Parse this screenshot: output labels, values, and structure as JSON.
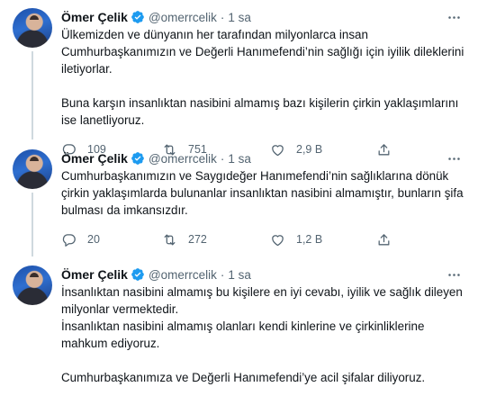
{
  "tweets": [
    {
      "author": {
        "name": "Ömer Çelik",
        "handle": "@omerrcelik",
        "verified": true
      },
      "separator": "·",
      "time": "1 sa",
      "text": [
        "Ülkemizden ve dünyanın her tarafından milyonlarca insan Cumhurbaşkanımızın ve Değerli Hanımefendi’nin sağlığı için iyilik dileklerini iletiyorlar.",
        "Buna karşın insanlıktan nasibini almamış bazı kişilerin çirkin yaklaşımlarını ise lanetliyoruz."
      ],
      "replies": "109",
      "retweets": "751",
      "likes": "2,9 B"
    },
    {
      "author": {
        "name": "Ömer Çelik",
        "handle": "@omerrcelik",
        "verified": true
      },
      "separator": "·",
      "time": "1 sa",
      "text": [
        "Cumhurbaşkanımızın ve Saygıdeğer Hanımefendi’nin sağlıklarına dönük çirkin yaklaşımlarda bulunanlar insanlıktan nasibini almamıştır, bunların şifa bulması da imkansızdır."
      ],
      "replies": "20",
      "retweets": "272",
      "likes": "1,2 B"
    },
    {
      "author": {
        "name": "Ömer Çelik",
        "handle": "@omerrcelik",
        "verified": true
      },
      "separator": "·",
      "time": "1 sa",
      "text": [
        "İnsanlıktan nasibini almamış bu kişilere en iyi cevabı, iyilik ve sağlık dileyen milyonlar vermektedir.",
        "İnsanlıktan nasibini almamış olanları kendi kinlerine ve çirkinliklerine mahkum ediyoruz.",
        "Cumhurbaşkanımıza ve Değerli Hanımefendi’ye acil şifalar diliyoruz."
      ]
    }
  ],
  "colors": {
    "text": "#0f1419",
    "muted": "#536471",
    "verified": "#1d9bf0",
    "thread_line": "#cfd9de"
  },
  "icons": [
    "verified-badge-icon",
    "more-icon",
    "reply-icon",
    "retweet-icon",
    "like-icon",
    "share-icon"
  ]
}
